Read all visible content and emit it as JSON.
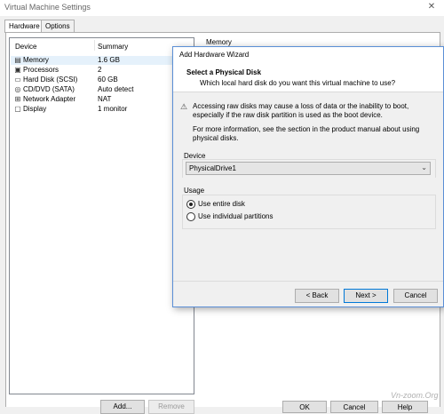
{
  "vm_window": {
    "title": "Virtual Machine Settings",
    "close_glyph": "✕",
    "tabs": [
      "Hardware",
      "Options"
    ],
    "device_list": {
      "col_device": "Device",
      "col_summary": "Summary",
      "rows": [
        {
          "device": "Memory",
          "summary": "1.6 GB",
          "icon": "memory-icon",
          "glyph": "▤"
        },
        {
          "device": "Processors",
          "summary": "2",
          "icon": "processor-icon",
          "glyph": "▣"
        },
        {
          "device": "Hard Disk (SCSI)",
          "summary": "60 GB",
          "icon": "hard-disk-icon",
          "glyph": "▭"
        },
        {
          "device": "CD/DVD (SATA)",
          "summary": "Auto detect",
          "icon": "cd-dvd-icon",
          "glyph": "◎"
        },
        {
          "device": "Network Adapter",
          "summary": "NAT",
          "icon": "network-adapter-icon",
          "glyph": "⊞"
        },
        {
          "device": "Display",
          "summary": "1 monitor",
          "icon": "display-icon",
          "glyph": "▢"
        }
      ]
    },
    "right_summary_label": "Memory",
    "add_button": "Add...",
    "remove_button": "Remove",
    "ok_button": "OK",
    "cancel_button": "Cancel",
    "help_button": "Help"
  },
  "watermark": "Vn-zoom.Org",
  "wizard": {
    "title": "Add Hardware Wizard",
    "header_title": "Select a Physical Disk",
    "header_subtitle": "Which local hard disk do you want this virtual machine to use?",
    "warning_icon": "⚠",
    "warning_text": "Accessing raw disks may cause a loss of data or the inability to boot, especially if the raw disk partition is used as the boot device.",
    "info_text": "For more information, see the section in the product manual about using physical disks.",
    "device_label": "Device",
    "device_value": "PhysicalDrive1",
    "chevron": "⌄",
    "usage_label": "Usage",
    "usage_options": [
      {
        "label": "Use entire disk",
        "selected": true
      },
      {
        "label": "Use individual partitions",
        "selected": false
      }
    ],
    "back_button": "< Back",
    "next_button": "Next >",
    "cancel_button": "Cancel"
  }
}
